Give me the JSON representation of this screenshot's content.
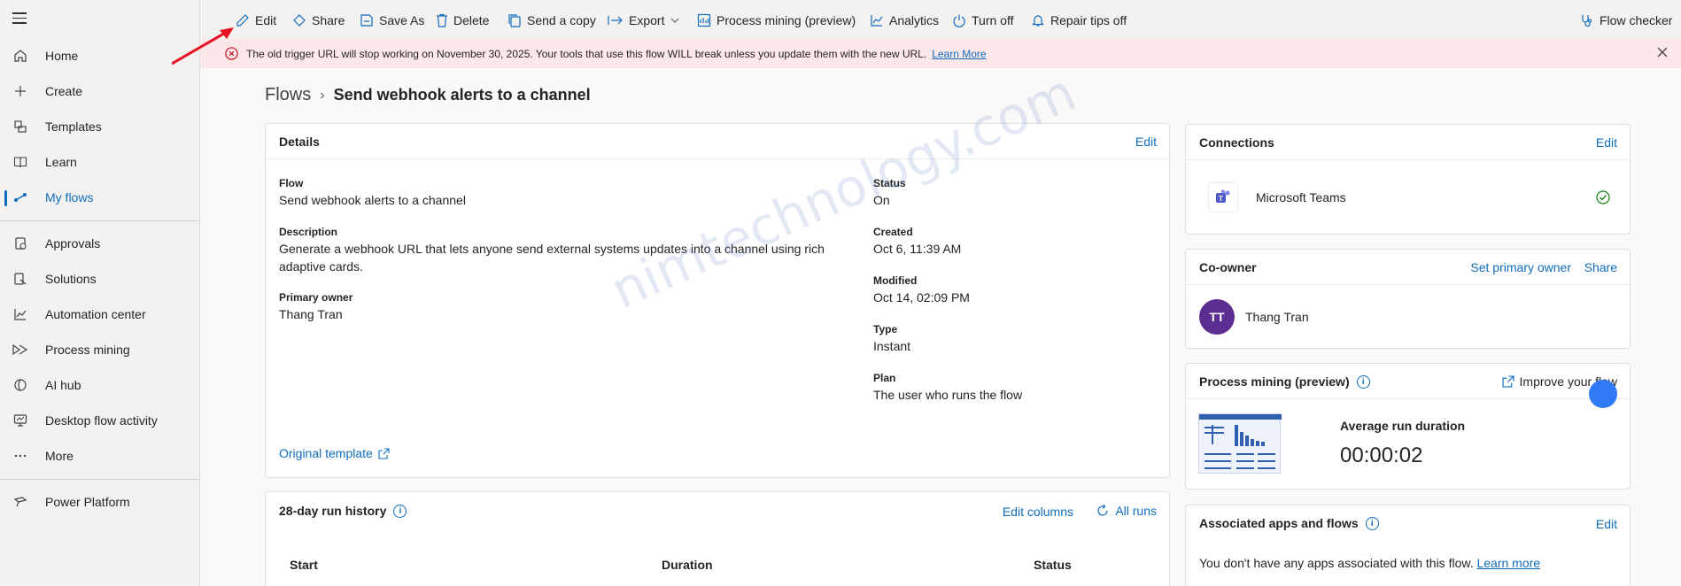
{
  "sidebar": {
    "items": [
      {
        "label": "Home",
        "icon": "home-icon"
      },
      {
        "label": "Create",
        "icon": "plus-icon"
      },
      {
        "label": "Templates",
        "icon": "templates-icon"
      },
      {
        "label": "Learn",
        "icon": "book-icon"
      },
      {
        "label": "My flows",
        "icon": "flow-icon",
        "active": true
      },
      {
        "label": "Approvals",
        "icon": "approvals-icon"
      },
      {
        "label": "Solutions",
        "icon": "solutions-icon"
      },
      {
        "label": "Automation center",
        "icon": "chart-icon"
      },
      {
        "label": "Process mining",
        "icon": "process-mining-icon"
      },
      {
        "label": "AI hub",
        "icon": "ai-hub-icon"
      },
      {
        "label": "Desktop flow activity",
        "icon": "desktop-activity-icon"
      },
      {
        "label": "More",
        "icon": "more-icon"
      },
      {
        "label": "Power Platform",
        "icon": "power-platform-icon"
      }
    ]
  },
  "toolbar": {
    "edit": "Edit",
    "share": "Share",
    "save_as": "Save As",
    "delete": "Delete",
    "send_copy": "Send a copy",
    "export": "Export",
    "process_mining": "Process mining (preview)",
    "analytics": "Analytics",
    "turn_off": "Turn off",
    "repair_tips": "Repair tips off",
    "flow_checker": "Flow checker"
  },
  "banner": {
    "message": "The old trigger URL will stop working on November 30, 2025. Your tools that use this flow WILL break unless you update them with the new URL.",
    "link": "Learn More",
    "color": "#fde7e9"
  },
  "breadcrumb": {
    "root": "Flows",
    "current": "Send webhook alerts to a channel"
  },
  "details": {
    "title": "Details",
    "edit": "Edit",
    "flow_label": "Flow",
    "flow_value": "Send webhook alerts to a channel",
    "description_label": "Description",
    "description_value": "Generate a webhook URL that lets anyone send external systems updates into a channel using rich adaptive cards.",
    "owner_label": "Primary owner",
    "owner_value": "Thang Tran",
    "status_label": "Status",
    "status_value": "On",
    "created_label": "Created",
    "created_value": "Oct 6, 11:39 AM",
    "modified_label": "Modified",
    "modified_value": "Oct 14, 02:09 PM",
    "type_label": "Type",
    "type_value": "Instant",
    "plan_label": "Plan",
    "plan_value": "The user who runs the flow",
    "original_template": "Original template"
  },
  "run_history": {
    "title": "28-day run history",
    "edit_columns": "Edit columns",
    "all_runs": "All runs",
    "columns": [
      "Start",
      "Duration",
      "Status"
    ]
  },
  "connections": {
    "title": "Connections",
    "edit": "Edit",
    "items": [
      {
        "name": "Microsoft Teams",
        "icon": "teams-icon",
        "status": "ok"
      }
    ]
  },
  "coowner": {
    "title": "Co-owner",
    "set_primary": "Set primary owner",
    "share": "Share",
    "initials": "TT",
    "name": "Thang Tran"
  },
  "process_mining": {
    "title": "Process mining (preview)",
    "improve": "Improve your flow",
    "avg_label": "Average run duration",
    "avg_value": "00:00:02"
  },
  "associated": {
    "title": "Associated apps and flows",
    "edit": "Edit",
    "message": "You don't have any apps associated with this flow.",
    "link": "Learn more"
  },
  "watermark": "nimtechnology.com",
  "colors": {
    "accent": "#0f6cbd",
    "avatar": "#5c2e91",
    "annotation_arrow": "#e81123"
  }
}
